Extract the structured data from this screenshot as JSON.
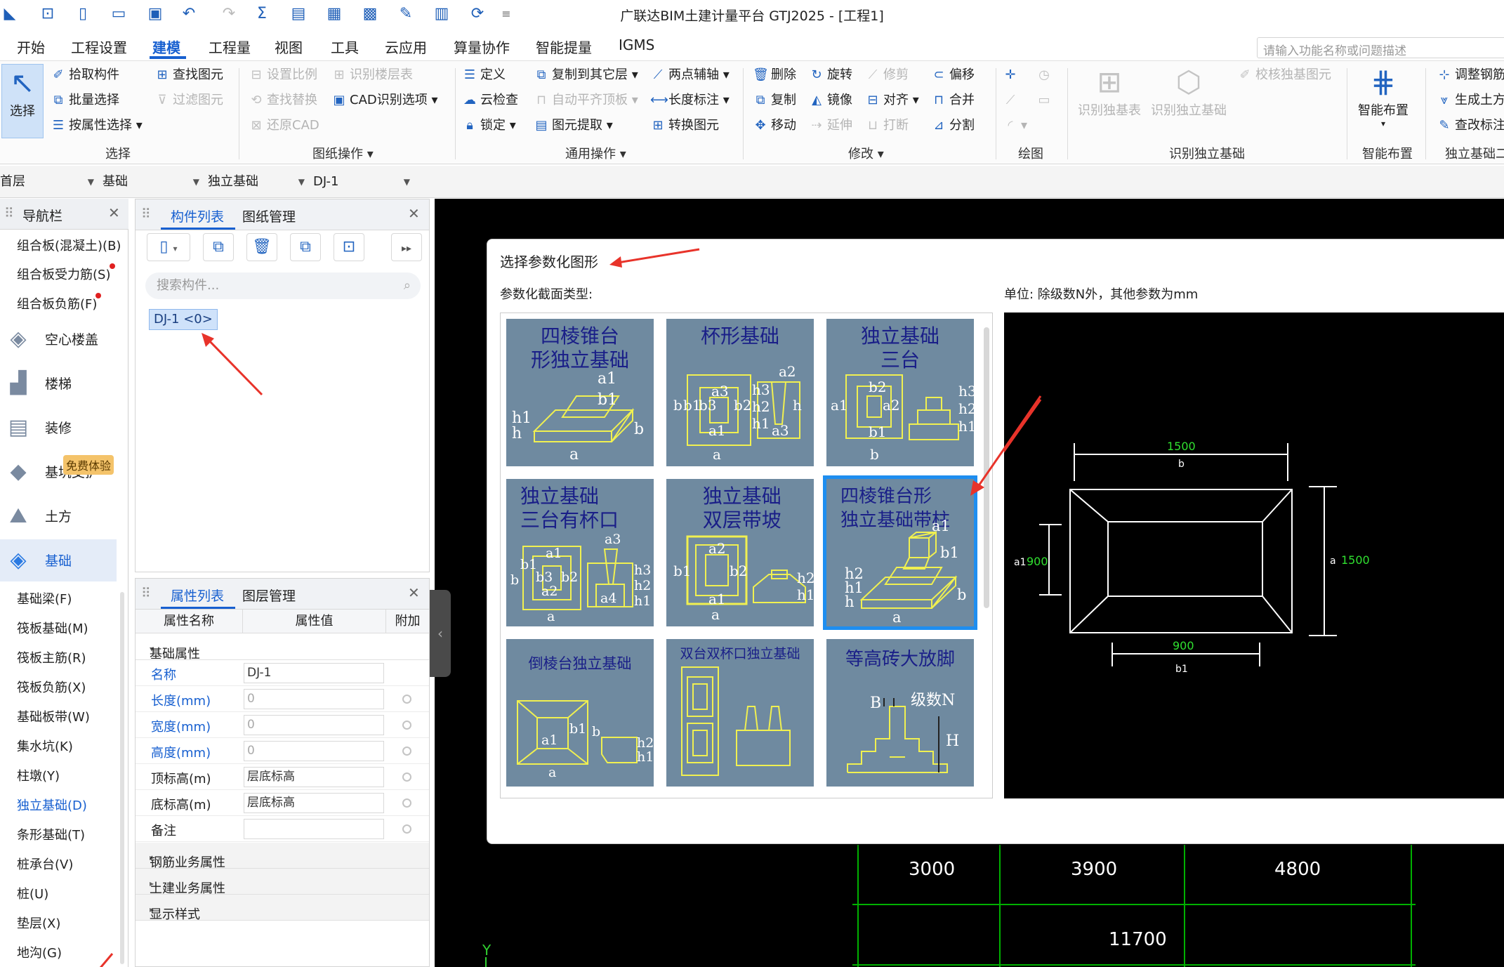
{
  "window": {
    "title": "广联达BIM土建计量平台 GTJ2025 - [工程1]",
    "quick_access": [
      "logo",
      "new-icon",
      "new-file-icon",
      "open-icon",
      "save-icon",
      "undo-icon",
      "redo-icon",
      "sum-icon",
      "report-icon",
      "grid-icon",
      "layer-icon",
      "draw-icon",
      "ruler-icon",
      "sync-icon",
      "more-icon"
    ]
  },
  "menu": {
    "items": [
      "开始",
      "工程设置",
      "建模",
      "工程量",
      "视图",
      "工具",
      "云应用",
      "算量协作",
      "智能提量",
      "IGMS"
    ],
    "active": "建模",
    "search_placeholder": "请输入功能名称或问题描述"
  },
  "ribbon": {
    "select": {
      "big_label": "选择",
      "items": [
        "拾取构件",
        "批量选择",
        "按属性选择",
        "查找图元",
        "过滤图元"
      ],
      "group": "选择"
    },
    "drawing_ops": {
      "items": [
        "设置比例",
        "识别楼层表",
        "查找替换",
        "CAD识别选项",
        "还原CAD"
      ],
      "group": "图纸操作"
    },
    "general_ops": {
      "items": [
        "定义",
        "复制到其它层",
        "两点辅轴",
        "云检查",
        "自动平齐顶板",
        "长度标注",
        "锁定",
        "图元提取",
        "转换图元"
      ],
      "group": "通用操作"
    },
    "modify": {
      "items": [
        "删除",
        "旋转",
        "修剪",
        "偏移",
        "复制",
        "镜像",
        "对齐",
        "合并",
        "移动",
        "延伸",
        "打断",
        "分割"
      ],
      "group": "修改"
    },
    "draw": {
      "group": "绘图"
    },
    "recognize": {
      "items": [
        "识别独基表",
        "识别独立基础",
        "校核独基图元"
      ],
      "group": "识别独立基础"
    },
    "smart": {
      "big_label": "智能布置",
      "group": "智能布置"
    },
    "isolated": {
      "items": [
        "调整钢筋",
        "生成土方",
        "查改标注"
      ],
      "group": "独立基础二"
    }
  },
  "floorbar": {
    "floor": "首层",
    "category": "基础",
    "type": "独立基础",
    "component": "DJ-1"
  },
  "nav": {
    "title": "导航栏",
    "top_items": [
      "组合板(混凝土)(B)",
      "组合板受力筋(S)",
      "组合板负筋(F)"
    ],
    "categories": [
      "空心楼盖",
      "楼梯",
      "装修",
      "基坑支护",
      "土方",
      "基础"
    ],
    "active_category": "基础",
    "badge": "免费体验",
    "sub_items": [
      "基础梁(F)",
      "筏板基础(M)",
      "筏板主筋(R)",
      "筏板负筋(X)",
      "基础板带(W)",
      "集水坑(K)",
      "柱墩(Y)",
      "独立基础(D)",
      "条形基础(T)",
      "桩承台(V)",
      "桩(U)",
      "垫层(X)",
      "地沟(G)"
    ],
    "active_sub": "独立基础(D)"
  },
  "component_panel": {
    "tabs": [
      "构件列表",
      "图纸管理"
    ],
    "search_placeholder": "搜索构件...",
    "items": [
      "DJ-1 <0>"
    ]
  },
  "property_panel": {
    "tabs": [
      "属性列表",
      "图层管理"
    ],
    "columns": [
      "属性名称",
      "属性值",
      "附加"
    ],
    "section": "基础属性",
    "rows": [
      {
        "name": "名称",
        "value": "DJ-1"
      },
      {
        "name": "长度(mm)",
        "value": "0"
      },
      {
        "name": "宽度(mm)",
        "value": "0"
      },
      {
        "name": "高度(mm)",
        "value": "0"
      },
      {
        "name": "顶标高(m)",
        "value": "层底标高"
      },
      {
        "name": "底标高(m)",
        "value": "层底标高"
      },
      {
        "name": "备注",
        "value": ""
      }
    ],
    "collapsed_sections": [
      "钢筋业务属性",
      "土建业务属性",
      "显示样式"
    ]
  },
  "dialog": {
    "title": "选择参数化图形",
    "section_label": "参数化截面类型:",
    "unit_label": "单位:   除级数N外，其他参数为mm",
    "shapes": [
      {
        "title": "四棱锥台\n形独立基础"
      },
      {
        "title": "杯形基础"
      },
      {
        "title": "独立基础\n三台"
      },
      {
        "title": "独立基础\n三台有杯口"
      },
      {
        "title": "  独立基础\n  双层带坡"
      },
      {
        "title": "四棱锥台形\n独立基础带柱"
      },
      {
        "title": "倒棱台独立基础"
      },
      {
        "title": "双台双杯口独立基础"
      },
      {
        "title": "等高砖大放脚"
      }
    ],
    "shape_labels": {
      "s1": [
        "a1",
        "b1",
        "h1",
        "h",
        "a",
        "b"
      ],
      "s2": [
        "a2",
        "b",
        "b1",
        "b3",
        "a3",
        "b2",
        "h3",
        "h2",
        "h1",
        "h",
        "a1",
        "a3",
        "a"
      ],
      "s3": [
        "a1",
        "b2",
        "a2",
        "h3",
        "h2",
        "h1",
        "b1",
        "b"
      ],
      "s4": [
        "a3",
        "a1",
        "b1",
        "b3",
        "b2",
        "a2",
        "b",
        "a4",
        "h3",
        "h2",
        "h1",
        "a"
      ],
      "s5": [
        "a2",
        "b1",
        "b2",
        "a1",
        "a",
        "h2",
        "h1"
      ],
      "s6": [
        "a1",
        "b1",
        "h2",
        "h1",
        "h",
        "b",
        "a"
      ],
      "s7": [
        "b1",
        "a1",
        "a",
        "b",
        "h2",
        "h1"
      ],
      "s9": [
        "B",
        "级数N",
        "H"
      ]
    },
    "selected_index": 5,
    "preview": {
      "b": "1500",
      "b_label": "b",
      "a": "1500",
      "a_label": "a",
      "a1": "900",
      "a1_label": "a1",
      "b1": "900",
      "b1_label": "b1"
    }
  },
  "canvas_axes": {
    "dims": [
      "3000",
      "3900",
      "4800"
    ],
    "total": "11700",
    "y_label": "Y"
  }
}
